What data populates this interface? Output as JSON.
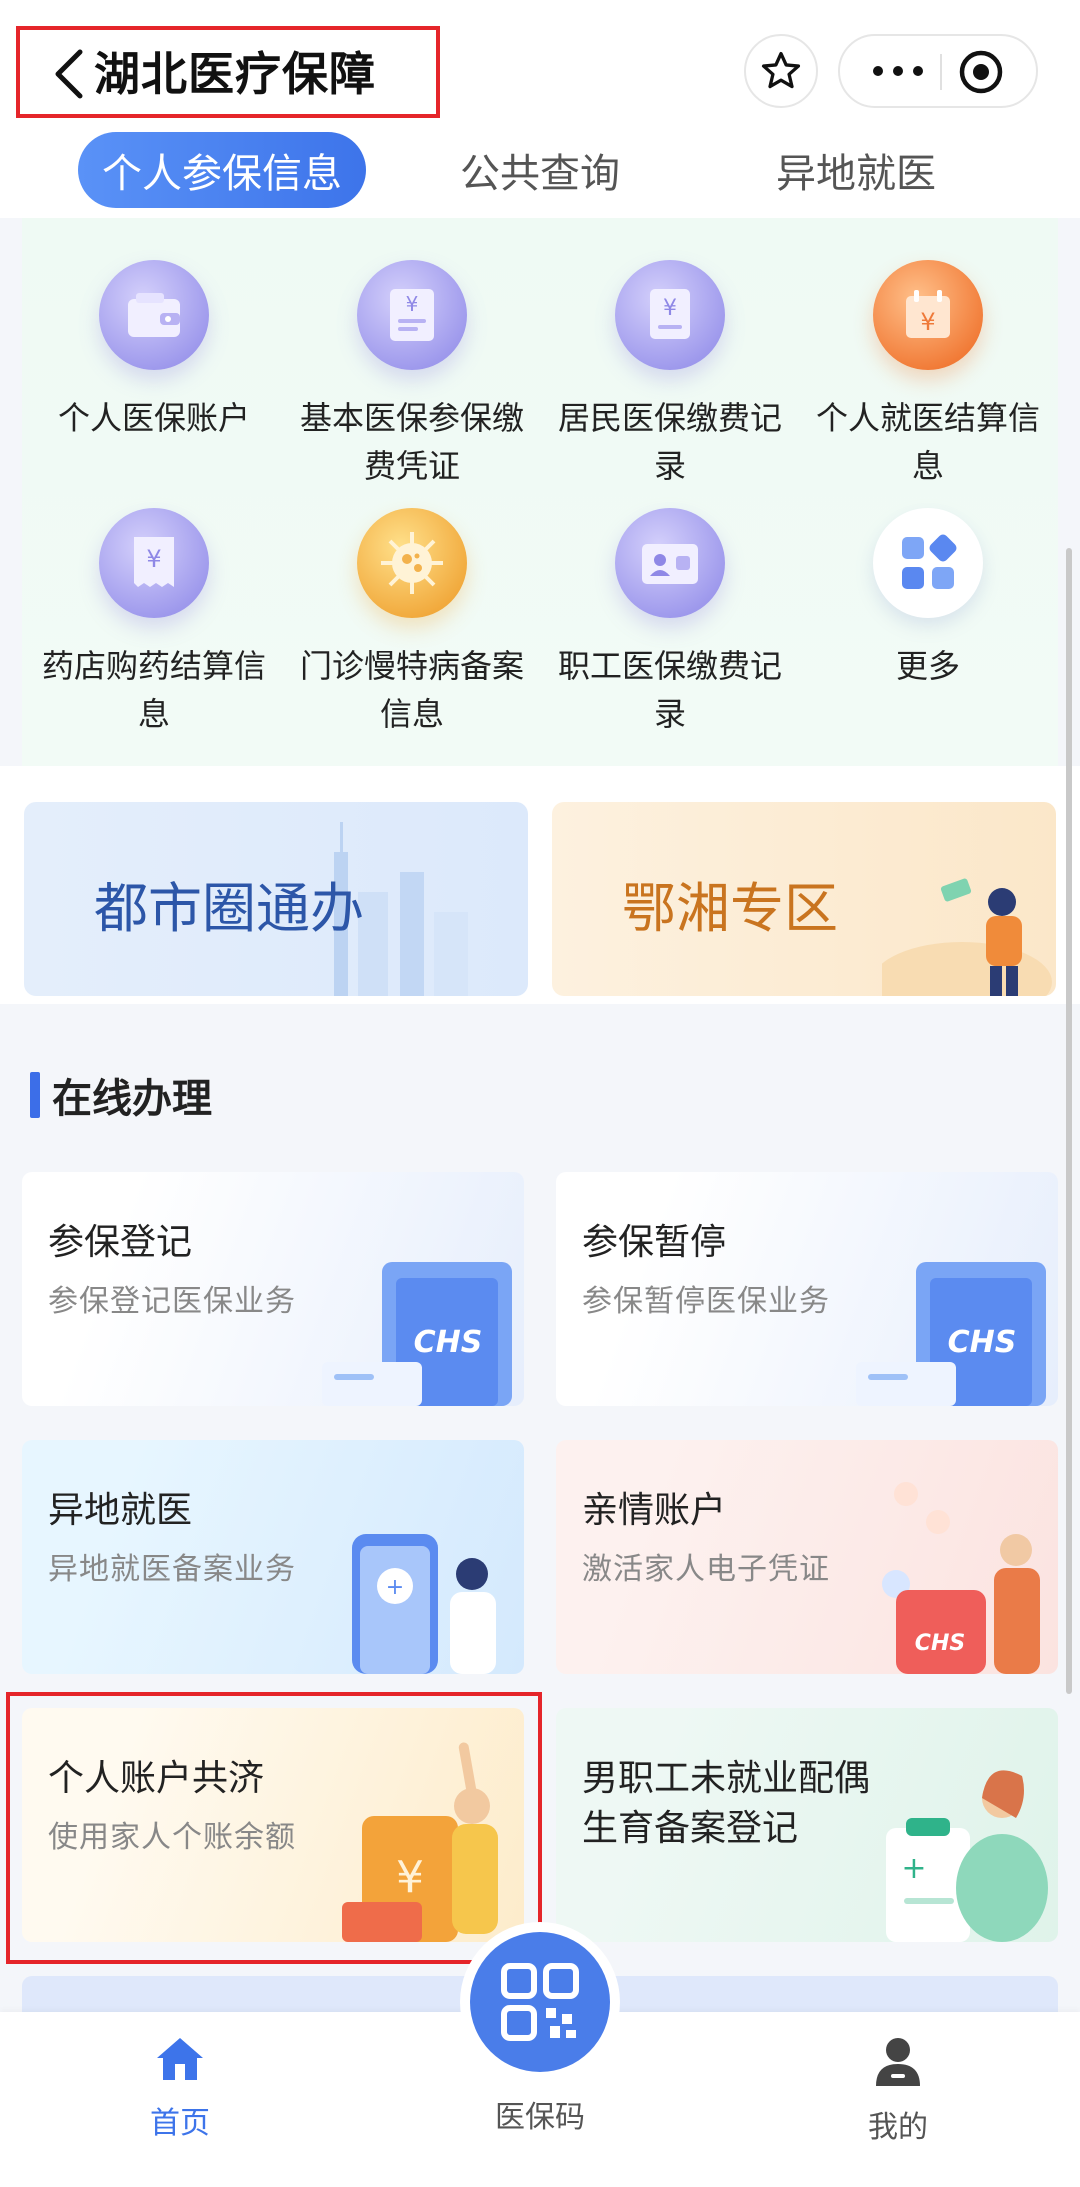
{
  "header": {
    "title": "湖北医疗保障",
    "back_icon": "chevron-left-icon",
    "star_icon": "star-icon",
    "more_icon": "more-dots-icon",
    "close_icon": "target-icon"
  },
  "tabs": [
    {
      "label": "个人参保信息",
      "active": true
    },
    {
      "label": "公共查询",
      "active": false
    },
    {
      "label": "异地就医",
      "active": false
    }
  ],
  "services": [
    {
      "label": "个人医保账户",
      "icon": "wallet-icon"
    },
    {
      "label": "基本医保参保缴费凭证",
      "icon": "yuan-document-icon"
    },
    {
      "label": "居民医保缴费记录",
      "icon": "yuan-receipt-icon"
    },
    {
      "label": "个人就医结算信息",
      "icon": "yuan-calendar-icon"
    },
    {
      "label": "药店购药结算信息",
      "icon": "yuan-ticket-icon"
    },
    {
      "label": "门诊慢特病备案信息",
      "icon": "virus-icon"
    },
    {
      "label": "职工医保缴费记录",
      "icon": "id-card-icon"
    },
    {
      "label": "更多",
      "icon": "grid-more-icon"
    }
  ],
  "banners": {
    "left": "都市圈通办",
    "right": "鄂湘专区"
  },
  "online": {
    "title": "在线办理",
    "cards": [
      {
        "title": "参保登记",
        "subtitle": "参保登记医保业务"
      },
      {
        "title": "参保暂停",
        "subtitle": "参保暂停医保业务"
      },
      {
        "title": "异地就医",
        "subtitle": "异地就医备案业务"
      },
      {
        "title": "亲情账户",
        "subtitle": "激活家人电子凭证"
      },
      {
        "title": "个人账户共济",
        "subtitle": "使用家人个账余额"
      },
      {
        "title": "男职工未就业配偶生育备案登记",
        "subtitle": ""
      }
    ],
    "chs_text": "CHS"
  },
  "bottom_nav": {
    "home": "首页",
    "qr": "医保码",
    "mine": "我的"
  },
  "colors": {
    "accent": "#3d74ea",
    "highlight": "#e5252a"
  }
}
